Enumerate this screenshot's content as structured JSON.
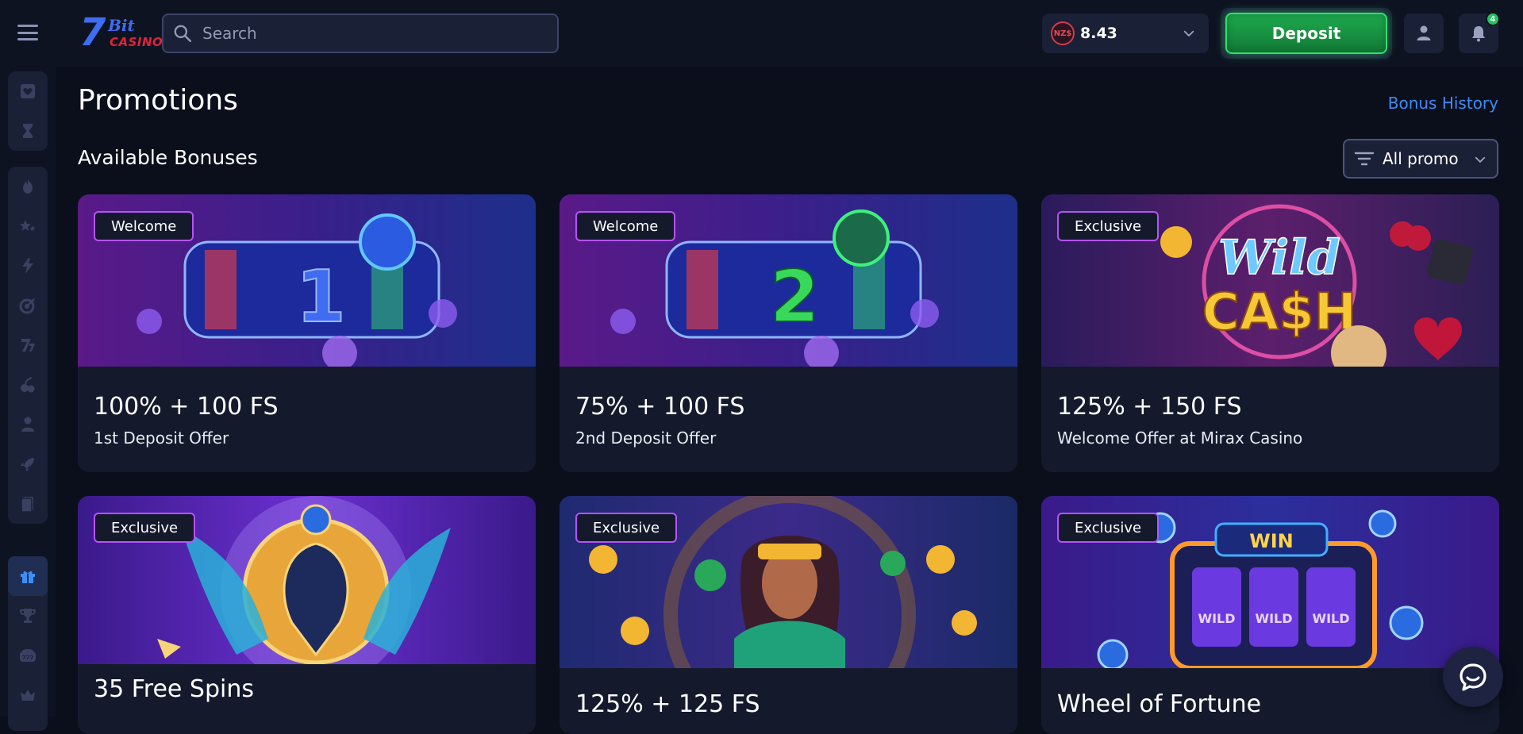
{
  "header": {
    "search_placeholder": "Search",
    "balance": {
      "currency_badge": "NZ$",
      "amount": "8.43"
    },
    "deposit_label": "Deposit",
    "notification_count": "4",
    "logo": {
      "top": "Bit",
      "bottom": "CASINO",
      "mark": "7"
    }
  },
  "sidebar": {
    "groups": [
      [
        "favorites-icon",
        "recent-icon"
      ],
      [
        "hot-icon",
        "new-icon",
        "bonus-buy-icon",
        "target-icon",
        "slots-icon",
        "table-games-icon",
        "live-dealer-icon",
        "crash-icon",
        "cards-icon"
      ],
      [
        "promotions-icon",
        "tournaments-icon",
        "jackpot-icon",
        "vip-icon"
      ]
    ],
    "active": "promotions-icon"
  },
  "main": {
    "title": "Promotions",
    "bonus_history": "Bonus History",
    "section_title": "Available Bonuses",
    "filter_label": "All promo",
    "cards": [
      {
        "badge": "Welcome",
        "title": "100% + 100 FS",
        "subtitle": "1st Deposit Offer"
      },
      {
        "badge": "Welcome",
        "title": "75% + 100 FS",
        "subtitle": "2nd Deposit Offer"
      },
      {
        "badge": "Exclusive",
        "title": "125% + 150 FS",
        "subtitle": "Welcome Offer at Mirax Casino"
      },
      {
        "badge": "Exclusive",
        "title": "35 Free Spins",
        "subtitle": ""
      },
      {
        "badge": "Exclusive",
        "title": "125% + 125 FS",
        "subtitle": ""
      },
      {
        "badge": "Exclusive",
        "title": "Wheel of Fortune",
        "subtitle": ""
      }
    ]
  },
  "colors": {
    "background": "#0b0f1c",
    "surface": "#141a2c",
    "accent_blue": "#3c8cf5",
    "deposit_green": "#1ea94e",
    "badge_border": "#b552ff"
  }
}
